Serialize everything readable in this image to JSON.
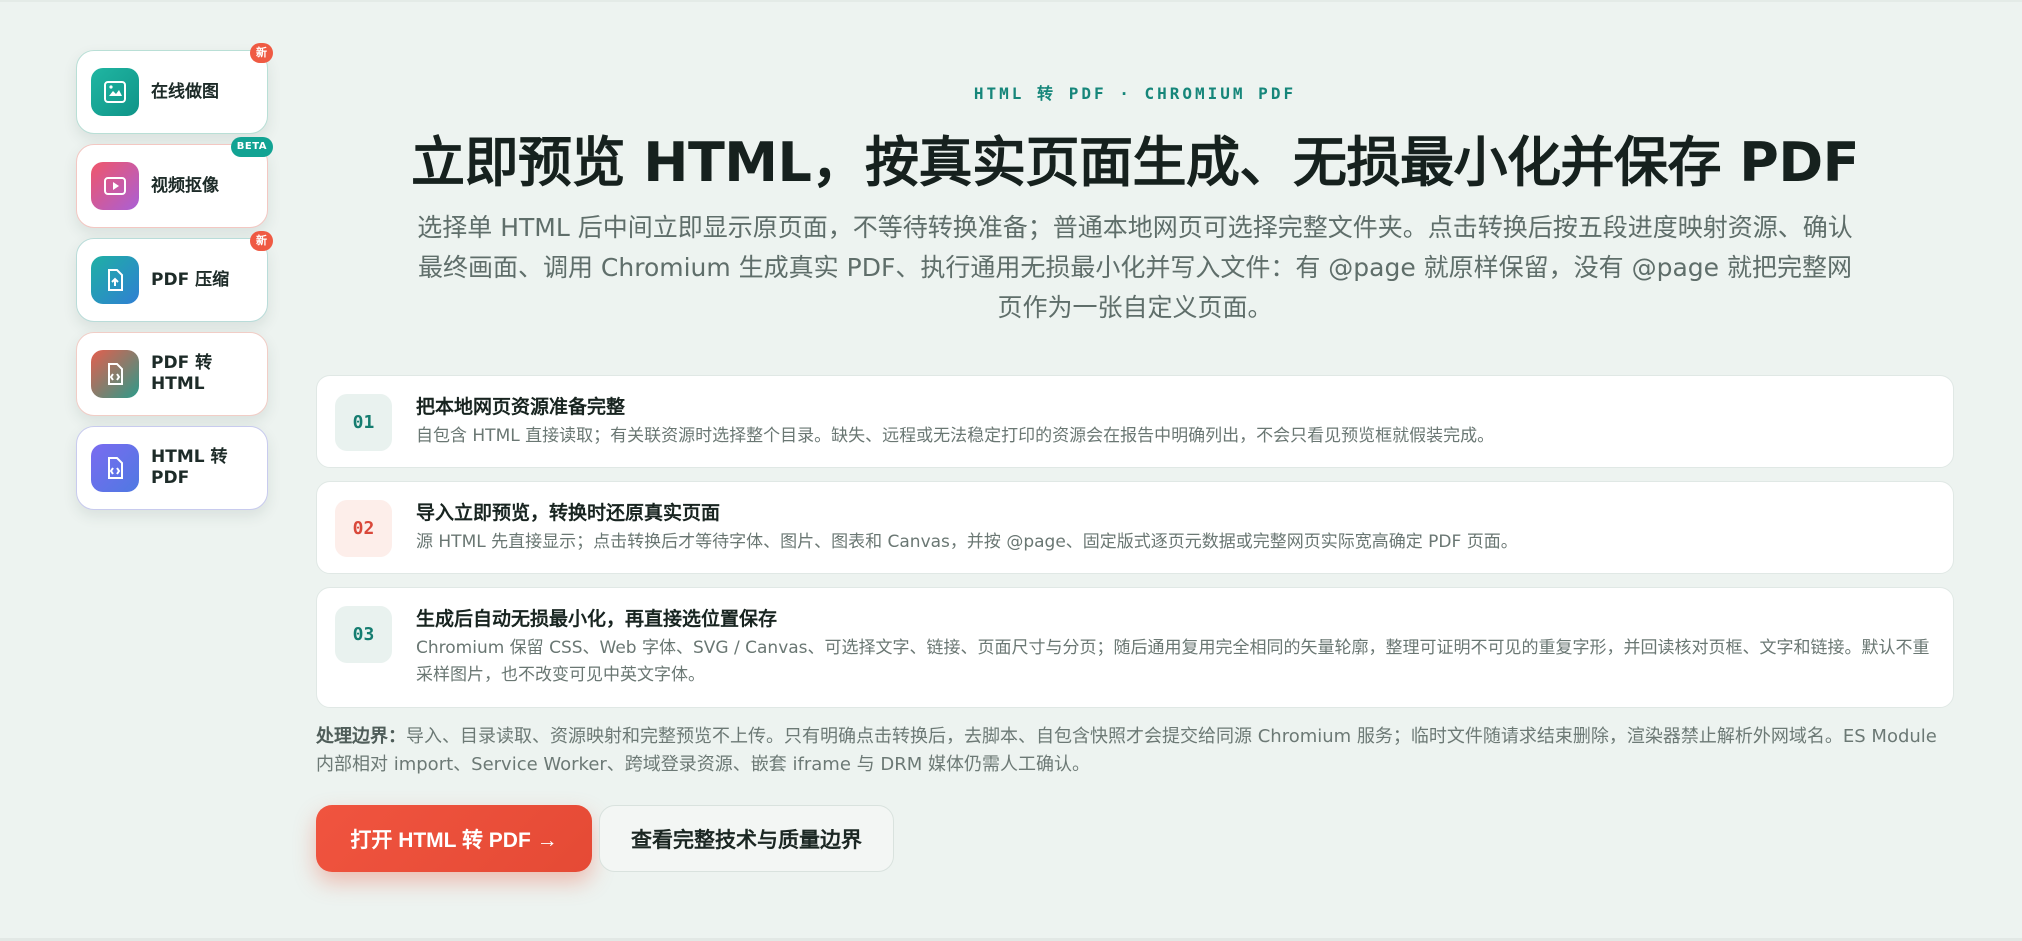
{
  "sidebar": {
    "items": [
      {
        "label": "在线做图",
        "badge": "新",
        "icon": "image-frame-icon"
      },
      {
        "label": "视频抠像",
        "badge": "BETA",
        "icon": "video-play-icon"
      },
      {
        "label": "PDF 压缩",
        "badge": "新",
        "icon": "file-upload-icon"
      },
      {
        "label": "PDF 转 HTML",
        "badge": "",
        "icon": "file-code-icon"
      },
      {
        "label": "HTML 转 PDF",
        "badge": "",
        "icon": "file-code-icon"
      }
    ]
  },
  "hero": {
    "kicker": "HTML 转 PDF · CHROMIUM PDF",
    "title": "立即预览 HTML，按真实页面生成、无损最小化并保存 PDF",
    "lead": "选择单 HTML 后中间立即显示原页面，不等待转换准备；普通本地网页可选择完整文件夹。点击转换后按五段进度映射资源、确认最终画面、调用 Chromium 生成真实 PDF、执行通用无损最小化并写入文件：有 @page 就原样保留，没有 @page 就把完整网页作为一张自定义页面。"
  },
  "steps": [
    {
      "num": "01",
      "title": "把本地网页资源准备完整",
      "desc": "自包含 HTML 直接读取；有关联资源时选择整个目录。缺失、远程或无法稳定打印的资源会在报告中明确列出，不会只看见预览框就假装完成。"
    },
    {
      "num": "02",
      "title": "导入立即预览，转换时还原真实页面",
      "desc": "源 HTML 先直接显示；点击转换后才等待字体、图片、图表和 Canvas，并按 @page、固定版式逐页元数据或完整网页实际宽高确定 PDF 页面。"
    },
    {
      "num": "03",
      "title": "生成后自动无损最小化，再直接选位置保存",
      "desc": "Chromium 保留 CSS、Web 字体、SVG / Canvas、可选择文字、链接、页面尺寸与分页；随后通用复用完全相同的矢量轮廓，整理可证明不可见的重复字形，并回读核对页框、文字和链接。默认不重采样图片，也不改变可见中英文字体。"
    }
  ],
  "note": {
    "label": "处理边界：",
    "text": "导入、目录读取、资源映射和完整预览不上传。只有明确点击转换后，去脚本、自包含快照才会提交给同源 Chromium 服务；临时文件随请求结束删除，渲染器禁止解析外网域名。ES Module 内部相对 import、Service Worker、跨域登录资源、嵌套 iframe 与 DRM 媒体仍需人工确认。"
  },
  "actions": {
    "primary": "打开 HTML 转 PDF →",
    "secondary": "查看完整技术与质量边界"
  },
  "colors": {
    "accent": "#ef5a43",
    "teal": "#16867a",
    "background": "#edf3f0"
  }
}
